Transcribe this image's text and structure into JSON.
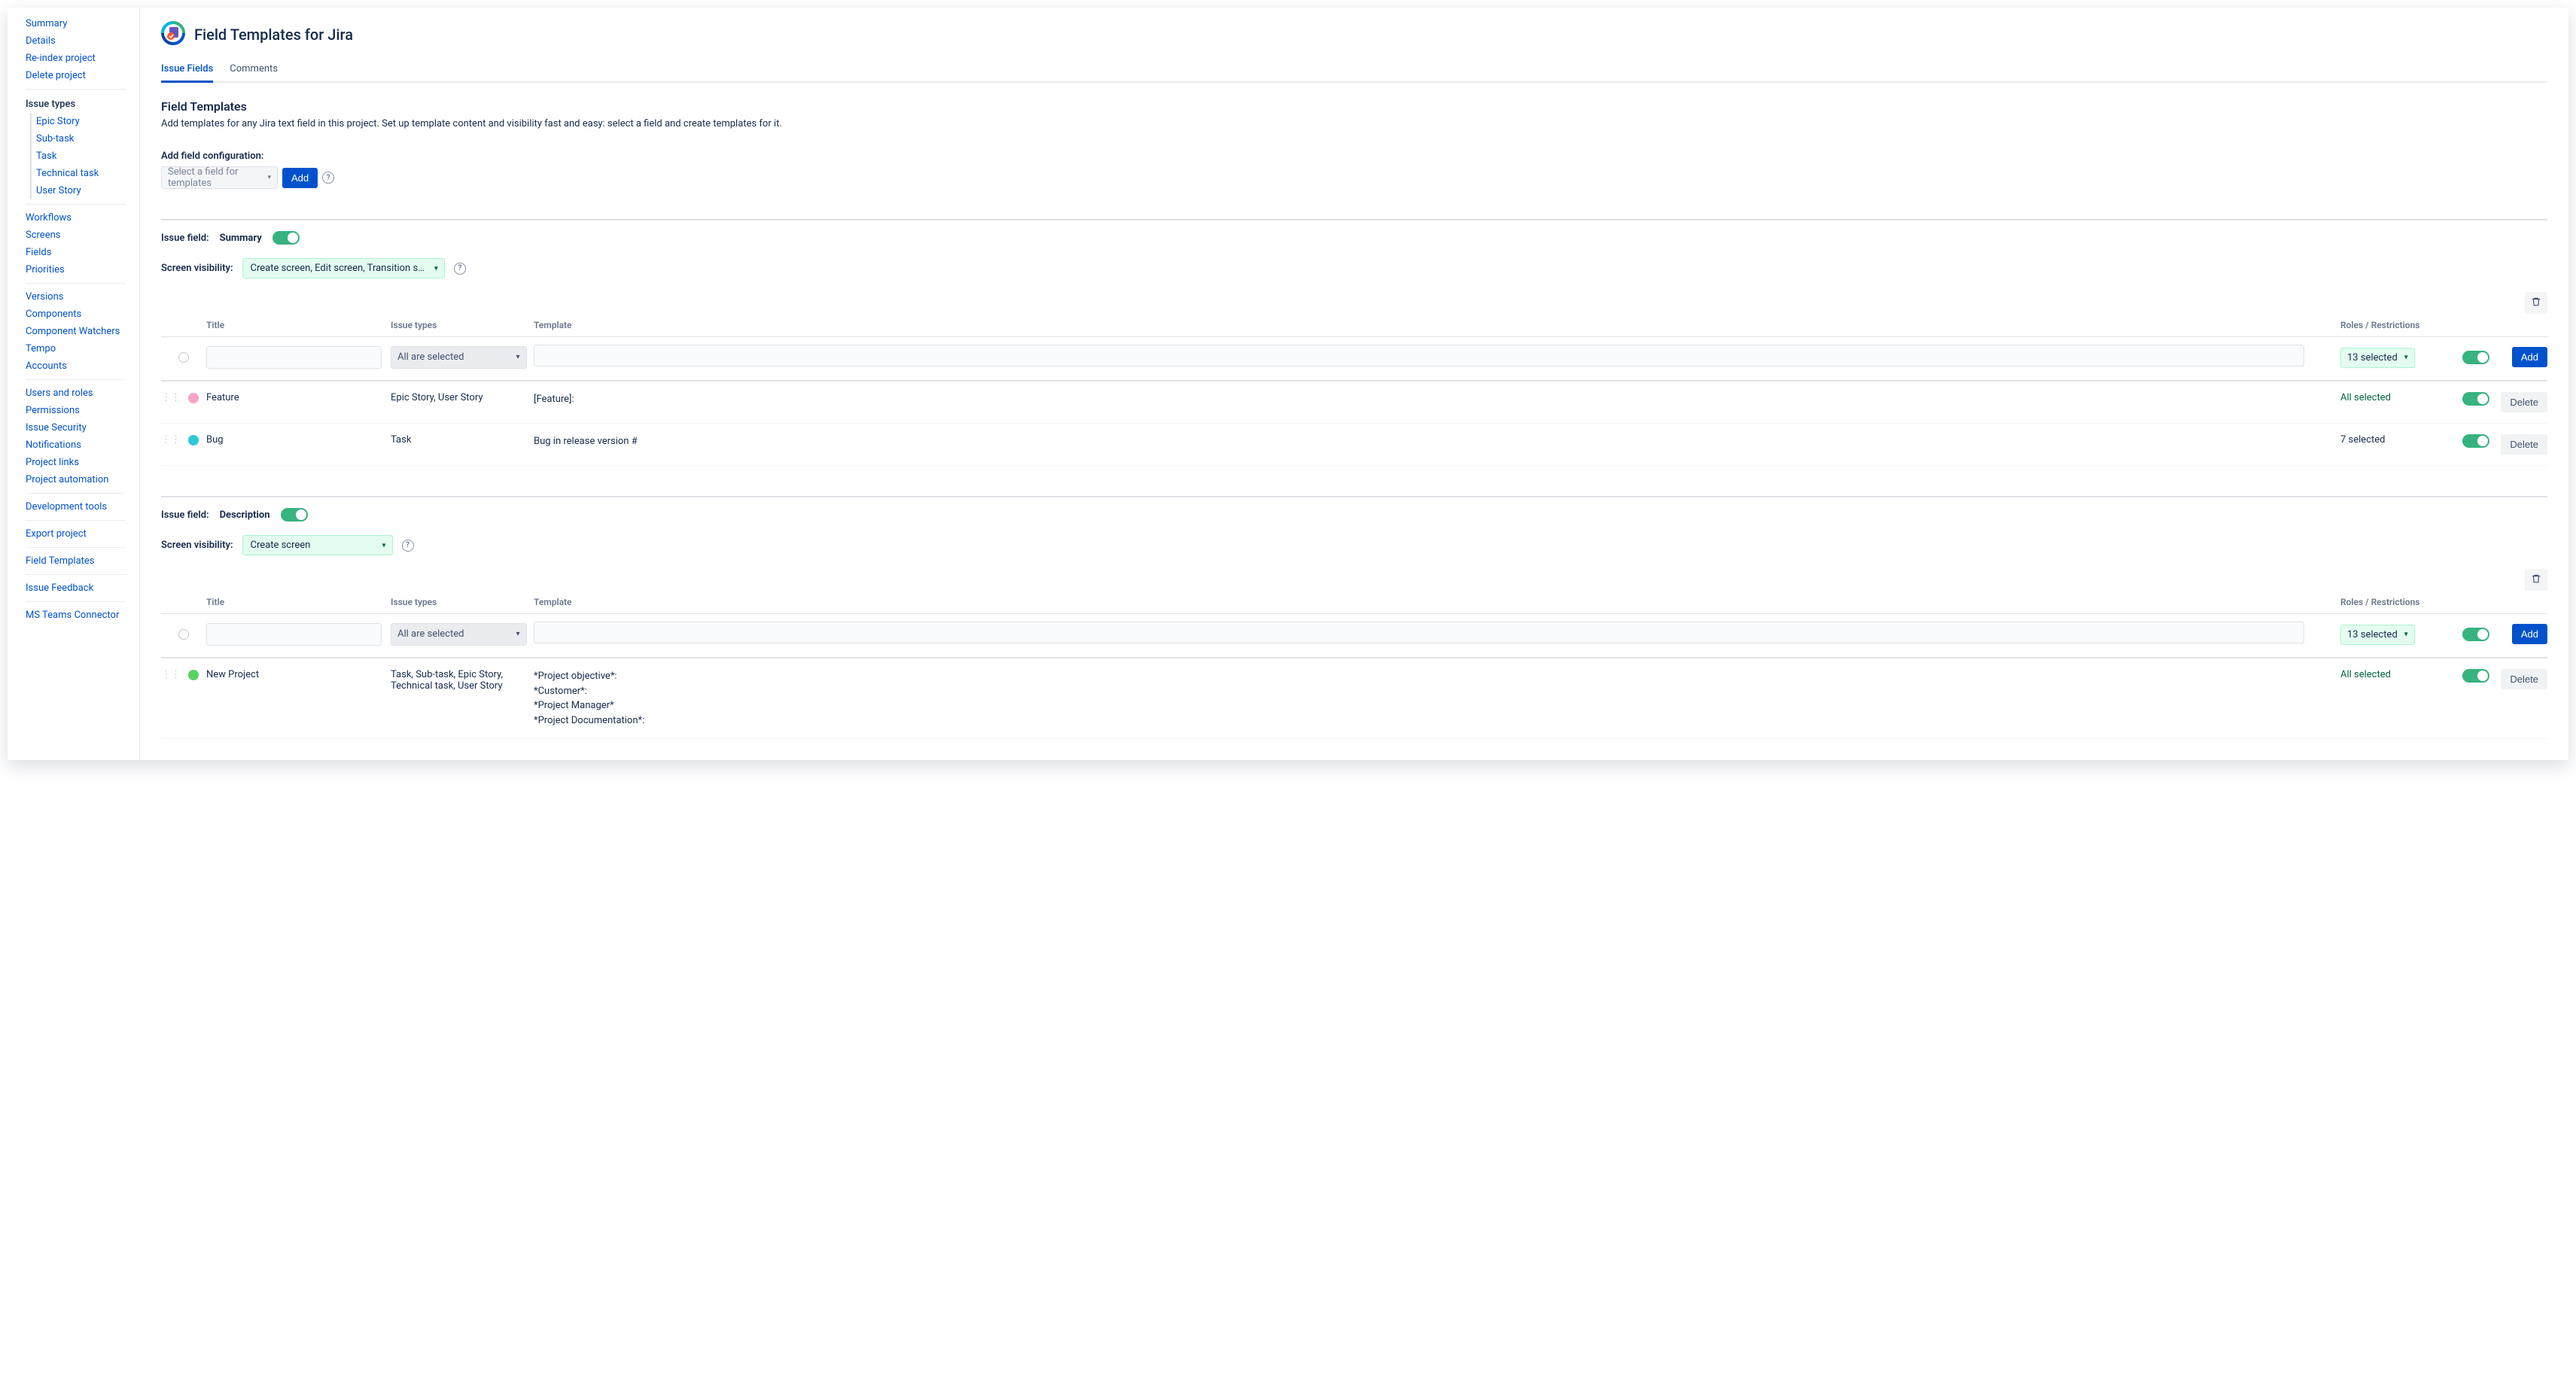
{
  "sidebar": {
    "top": [
      "Summary",
      "Details",
      "Re-index project",
      "Delete project"
    ],
    "issue_types_head": "Issue types",
    "issue_types": [
      "Epic Story",
      "Sub-task",
      "Task",
      "Technical task",
      "User Story"
    ],
    "group2": [
      "Workflows",
      "Screens",
      "Fields",
      "Priorities"
    ],
    "group3": [
      "Versions",
      "Components",
      "Component Watchers",
      "Tempo",
      "Accounts"
    ],
    "group4": [
      "Users and roles",
      "Permissions",
      "Issue Security",
      "Notifications",
      "Project links",
      "Project automation"
    ],
    "group5": [
      "Development tools"
    ],
    "group6": [
      "Export project"
    ],
    "group7": [
      "Field Templates"
    ],
    "group8": [
      "Issue Feedback"
    ],
    "group9": [
      "MS Teams Connector"
    ]
  },
  "page": {
    "title": "Field Templates for Jira",
    "tabs": {
      "active": "Issue Fields",
      "other": "Comments"
    },
    "section_title": "Field Templates",
    "section_desc": "Add templates for any Jira text field in this project. Set up template content and visibility fast and easy: select a field and create templates for it.",
    "add_config_label": "Add field configuration:",
    "select_placeholder": "Select a field for templates",
    "add_btn": "Add"
  },
  "labels": {
    "issue_field": "Issue field:",
    "screen_visibility": "Screen visibility:",
    "cols": {
      "title": "Title",
      "issue_types": "Issue types",
      "template": "Template",
      "roles": "Roles / Restrictions"
    },
    "all_selected_opt": "All are selected",
    "add": "Add",
    "delete": "Delete"
  },
  "blocks": [
    {
      "field_name": "Summary",
      "screen_value": "Create screen, Edit screen, Transition s…",
      "input_roles": "13 selected",
      "rows": [
        {
          "color": "#F8A3C7",
          "title": "Feature",
          "types": "Epic Story, User Story",
          "template": "[Feature]:",
          "roles": "All selected",
          "roles_all": true
        },
        {
          "color": "#2EC7D6",
          "title": "Bug",
          "types": "Task",
          "template": "Bug in release version #",
          "roles": "7 selected",
          "roles_all": false
        }
      ]
    },
    {
      "field_name": "Description",
      "screen_value": "Create screen",
      "input_roles": "13 selected",
      "rows": [
        {
          "color": "#57D463",
          "title": "New Project",
          "types": "Task, Sub-task, Epic Story, Technical task, User Story",
          "template": "*Project objective*:\n*Customer*:\n*Project Manager*\n*Project Documentation*:",
          "roles": "All selected",
          "roles_all": true
        }
      ]
    }
  ]
}
